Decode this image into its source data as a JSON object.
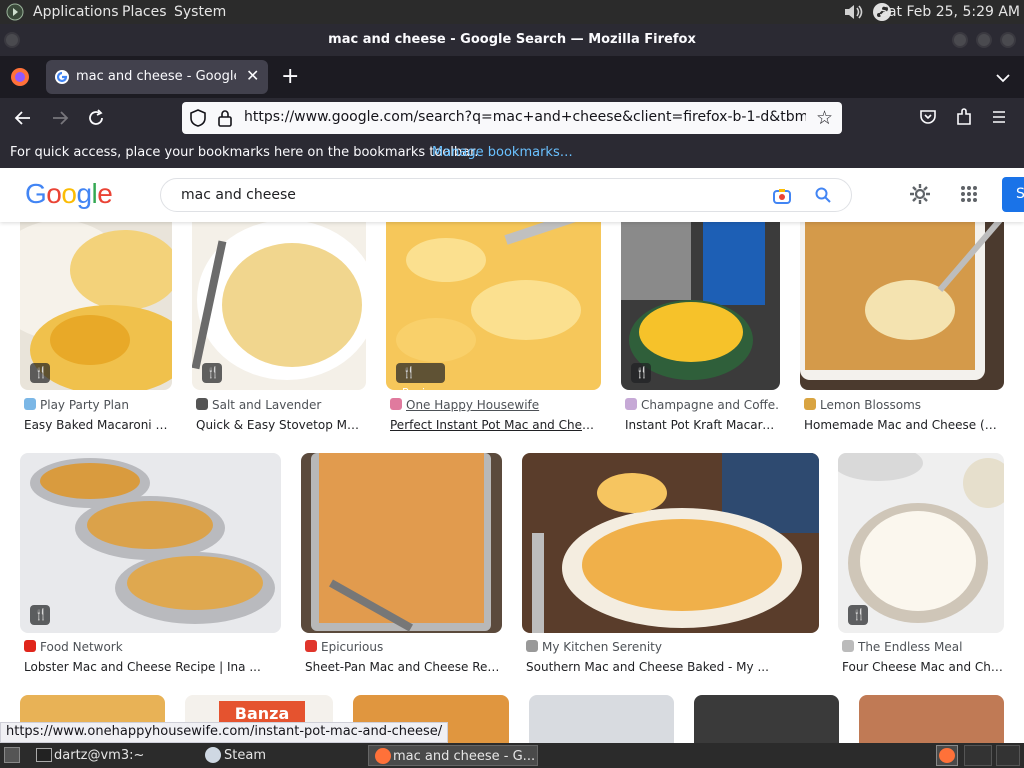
{
  "panel": {
    "menus": [
      "Applications",
      "Places",
      "System"
    ],
    "clock": "Sat Feb 25,  5:29 AM"
  },
  "window": {
    "title": "mac and cheese - Google Search — Mozilla Firefox"
  },
  "tab": {
    "title": "mac and cheese - Google Se"
  },
  "nav": {
    "url": "https://www.google.com/search?q=mac+and+cheese&client=firefox-b-1-d&tbm=isch&sou"
  },
  "bookmarks": {
    "message": "For quick access, place your bookmarks here on the bookmarks toolbar.",
    "link": "Manage bookmarks…"
  },
  "google": {
    "logo": "Google",
    "query": "mac and cheese",
    "signin_partial": "S"
  },
  "results": [
    {
      "source": "Play Party Plan",
      "title": "Easy Baked Macaroni an...",
      "has_recipe_icon": true
    },
    {
      "source": "Salt and Lavender",
      "title": "Quick & Easy Stovetop Mac ...",
      "has_recipe_icon": true
    },
    {
      "source": "One Happy Housewife",
      "title": "Perfect Instant Pot Mac and Cheese...",
      "badge": "Recipe"
    },
    {
      "source": "Champagne and Coffe...",
      "title": "Instant Pot Kraft Macaron...",
      "has_recipe_icon": true
    },
    {
      "source": "Lemon Blossoms",
      "title": "Homemade Mac and Cheese (Bak..."
    },
    {
      "source": "Food Network",
      "title": "Lobster Mac and Cheese Recipe | Ina ...",
      "has_recipe_icon": true
    },
    {
      "source": "Epicurious",
      "title": "Sheet-Pan Mac and Cheese Recip..."
    },
    {
      "source": "My Kitchen Serenity",
      "title": "Southern Mac and Cheese Baked - My ..."
    },
    {
      "source": "The Endless Meal",
      "title": "Four Cheese Mac and Che...",
      "has_recipe_icon": true
    }
  ],
  "row3": {
    "banza_text": "Banza"
  },
  "status_url": "https://www.onehappyhousewife.com/instant-pot-mac-and-cheese/",
  "taskbar": {
    "terminal": "dartz@vm3:~",
    "steam": "Steam",
    "firefox": "mac and cheese - G..."
  },
  "colors": {
    "google_blue": "#4285f4",
    "google_red": "#ea4335",
    "google_yellow": "#fbbc05",
    "google_green": "#34a853",
    "link_blue": "#1a0dab",
    "manage_link": "#6ac1ff"
  }
}
